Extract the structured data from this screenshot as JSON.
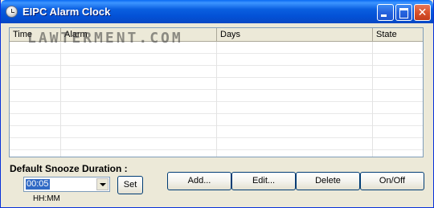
{
  "window": {
    "title": "EIPC Alarm Clock"
  },
  "titlebar_buttons": {
    "close_glyph": "✕"
  },
  "watermark": "LAWTERMENT.COM",
  "alarm_list": {
    "columns": [
      "Time",
      "Alarm",
      "Days",
      "State"
    ],
    "rows": []
  },
  "snooze": {
    "label": "Default Snooze Duration :",
    "value": "00:05",
    "format_hint": "HH:MM",
    "set_label": "Set"
  },
  "actions": {
    "add_label": "Add...",
    "edit_label": "Edit...",
    "delete_label": "Delete",
    "onoff_label": "On/Off"
  },
  "colors": {
    "titlebar": "#0351d6",
    "selection": "#316ac5",
    "face": "#ece9d8"
  }
}
